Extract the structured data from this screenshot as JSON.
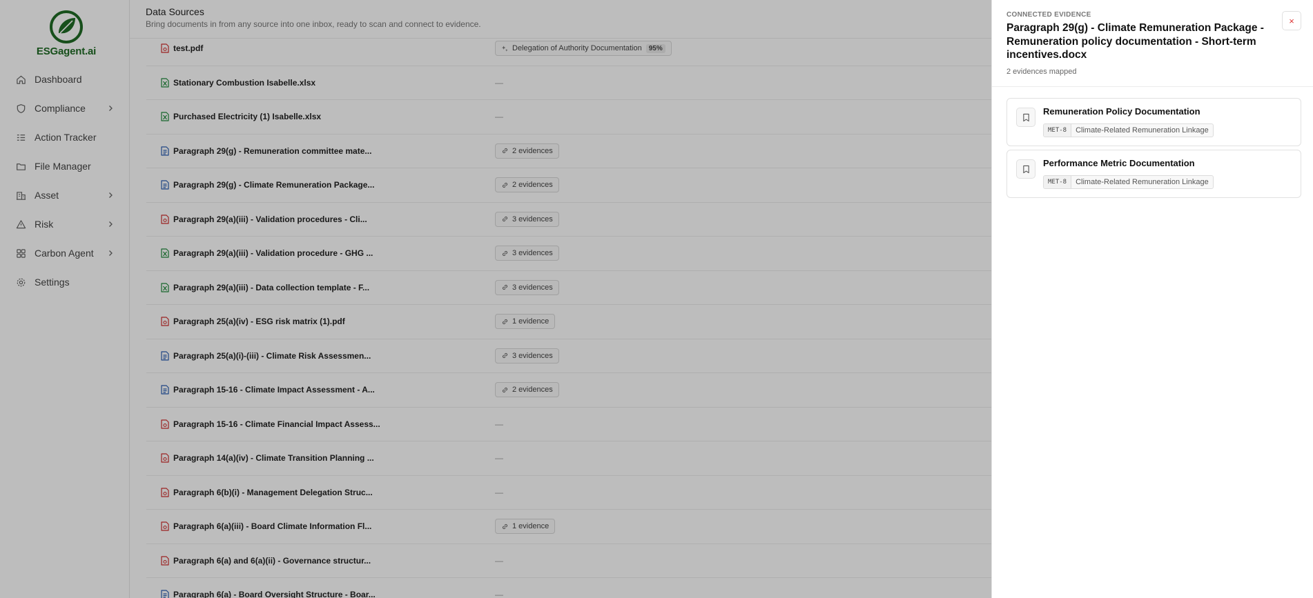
{
  "brand": {
    "name": "ESGagent.ai",
    "color": "#1f6b25"
  },
  "sidebar": {
    "items": [
      {
        "label": "Dashboard",
        "icon": "home-icon",
        "has_children": false
      },
      {
        "label": "Compliance",
        "icon": "shield-icon",
        "has_children": true
      },
      {
        "label": "Action Tracker",
        "icon": "list-icon",
        "has_children": false
      },
      {
        "label": "File Manager",
        "icon": "folder-icon",
        "has_children": false
      },
      {
        "label": "Asset",
        "icon": "building-icon",
        "has_children": true
      },
      {
        "label": "Risk",
        "icon": "warning-icon",
        "has_children": true
      },
      {
        "label": "Carbon Agent",
        "icon": "grid-icon",
        "has_children": true
      },
      {
        "label": "Settings",
        "icon": "gear-icon",
        "has_children": false
      }
    ]
  },
  "header": {
    "title": "Data Sources",
    "subtitle": "Bring documents in from any source into one inbox, ready to scan and connect to evidence."
  },
  "files": [
    {
      "name": "test.pdf",
      "type": "pdf",
      "evidence": "Delegation of Authority Documentation",
      "confidence": "95%",
      "kind": "suggestion"
    },
    {
      "name": "Stationary Combustion Isabelle.xlsx",
      "type": "xlsx",
      "evidence": "—",
      "kind": "none"
    },
    {
      "name": "Purchased Electricity (1) Isabelle.xlsx",
      "type": "xlsx",
      "evidence": "—",
      "kind": "none"
    },
    {
      "name": "Paragraph 29(g) - Remuneration committee mate...",
      "type": "docx",
      "evidence": "2 evidences",
      "kind": "link"
    },
    {
      "name": "Paragraph 29(g) - Climate Remuneration Package...",
      "type": "docx",
      "evidence": "2 evidences",
      "kind": "link"
    },
    {
      "name": "Paragraph 29(a)(iii) - Validation procedures - Cli...",
      "type": "pdf",
      "evidence": "3 evidences",
      "kind": "link"
    },
    {
      "name": "Paragraph 29(a)(iii) - Validation procedure - GHG ...",
      "type": "xlsx",
      "evidence": "3 evidences",
      "kind": "link"
    },
    {
      "name": "Paragraph 29(a)(iii) - Data collection template - F...",
      "type": "xlsx",
      "evidence": "3 evidences",
      "kind": "link"
    },
    {
      "name": "Paragraph 25(a)(iv) - ESG risk matrix (1).pdf",
      "type": "pdf",
      "evidence": "1 evidence",
      "kind": "link"
    },
    {
      "name": "Paragraph 25(a)(i)-(iii) - Climate Risk Assessmen...",
      "type": "docx",
      "evidence": "3 evidences",
      "kind": "link"
    },
    {
      "name": "Paragraph 15-16 - Climate Impact Assessment - A...",
      "type": "docx",
      "evidence": "2 evidences",
      "kind": "link"
    },
    {
      "name": "Paragraph 15-16 - Climate Financial Impact Assess...",
      "type": "pdf",
      "evidence": "—",
      "kind": "none"
    },
    {
      "name": "Paragraph 14(a)(iv) - Climate Transition Planning ...",
      "type": "pdf",
      "evidence": "—",
      "kind": "none"
    },
    {
      "name": "Paragraph 6(b)(i) - Management Delegation Struc...",
      "type": "pdf",
      "evidence": "—",
      "kind": "none"
    },
    {
      "name": "Paragraph 6(a)(iii) - Board Climate Information Fl...",
      "type": "pdf",
      "evidence": "1 evidence",
      "kind": "link"
    },
    {
      "name": "Paragraph 6(a) and 6(a)(ii) - Governance structur...",
      "type": "pdf",
      "evidence": "—",
      "kind": "none"
    },
    {
      "name": "Paragraph 6(a) - Board Oversight Structure - Boar...",
      "type": "docx",
      "evidence": "—",
      "kind": "none"
    }
  ],
  "drawer": {
    "eyebrow": "CONNECTED EVIDENCE",
    "title": "Paragraph 29(g) - Climate Remuneration Package - Remuneration policy documentation - Short-term incentives.docx",
    "count": "2 evidences mapped",
    "close": "×",
    "cards": [
      {
        "title": "Remuneration Policy Documentation",
        "code": "MET-8",
        "tag": "Climate-Related Remuneration Linkage"
      },
      {
        "title": "Performance Metric Documentation",
        "code": "MET-8",
        "tag": "Climate-Related Remuneration Linkage"
      }
    ]
  },
  "colors": {
    "pdf": "#d12f2f",
    "xlsx": "#1f8a3a",
    "docx": "#2b5fb3",
    "close": "#d33333"
  }
}
